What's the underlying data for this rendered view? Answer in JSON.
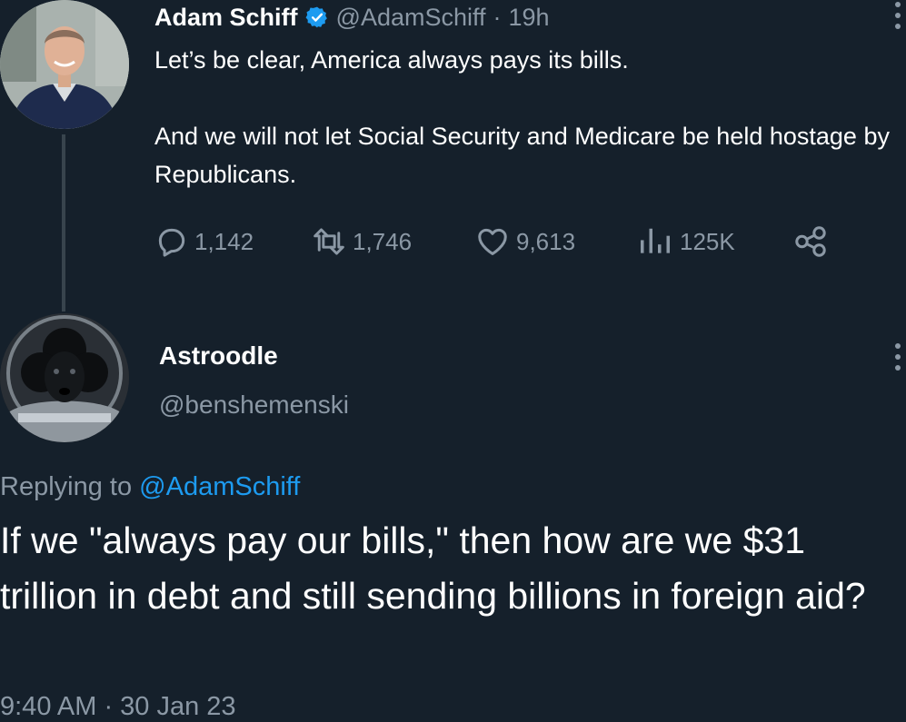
{
  "parent_tweet": {
    "display_name": "Adam Schiff",
    "verified": true,
    "handle": "@AdamSchiff",
    "separator": "·",
    "age": "19h",
    "text_line_1": "Let’s be clear, America always pays its bills.",
    "text_line_2": "And we will not let Social Security and Medicare be held hostage by Republicans.",
    "stats": {
      "replies": "1,142",
      "retweets": "1,746",
      "likes": "9,613",
      "views": "125K"
    },
    "icons": [
      "verified-icon",
      "reply-icon",
      "retweet-icon",
      "like-icon",
      "views-icon",
      "share-icon",
      "more-icon"
    ]
  },
  "reply_tweet": {
    "display_name": "Astroodle",
    "handle": "@benshemenski",
    "replying_prefix": "Replying to",
    "replying_to": "@AdamSchiff",
    "text": "If we \"always pay our bills,\" then how are we $31 trillion in debt and still sending billions in foreign aid?",
    "timestamp": "9:40 AM · 30 Jan 23"
  },
  "colors": {
    "background": "#15202b",
    "text_primary": "#ffffff",
    "text_secondary": "#8b98a5",
    "accent": "#1d9bf0",
    "thread_line": "#38444d"
  }
}
